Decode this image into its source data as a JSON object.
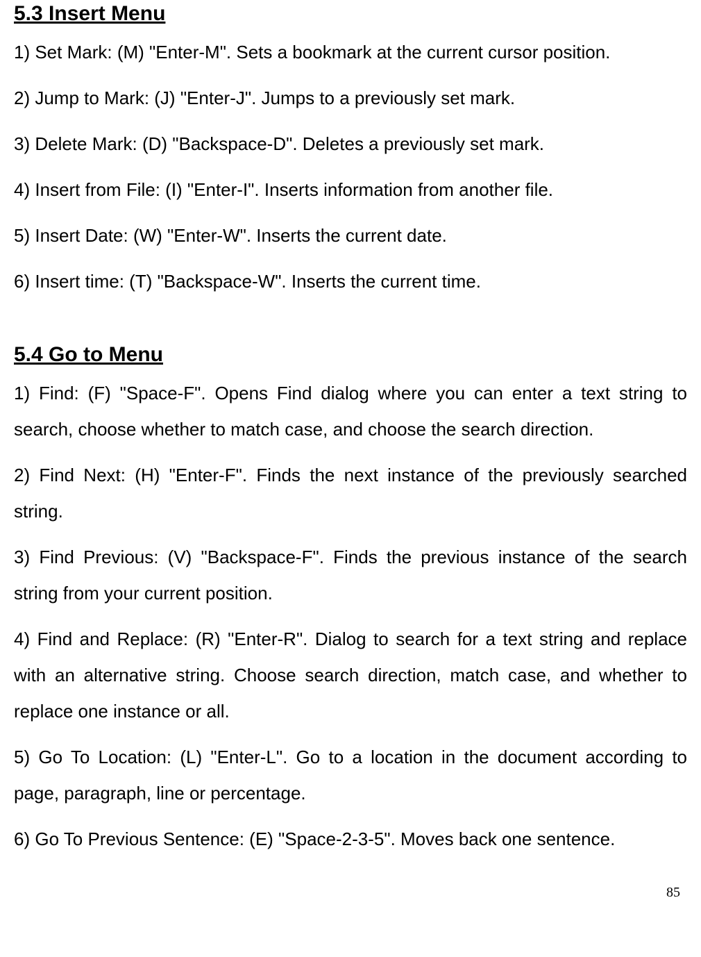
{
  "section53": {
    "heading": "5.3 Insert Menu",
    "items": [
      "1) Set Mark: (M) \"Enter-M\". Sets a bookmark at the current cursor position.",
      "2) Jump to Mark: (J) \"Enter-J\". Jumps to a previously set mark.",
      "3) Delete Mark: (D) \"Backspace-D\". Deletes a previously set mark.",
      "4) Insert from File: (I) \"Enter-I\". Inserts information from another file.",
      "5) Insert Date: (W) \"Enter-W\". Inserts the current date.",
      "6) Insert time: (T) \"Backspace-W\". Inserts the current time."
    ]
  },
  "section54": {
    "heading": "5.4 Go to Menu",
    "items": [
      "1) Find: (F) \"Space-F\". Opens Find dialog where you can enter a text string to search, choose whether to match case, and choose the search direction.",
      "2) Find Next: (H) \"Enter-F\". Finds the next instance of the previously searched string.",
      "3) Find Previous: (V) \"Backspace-F\". Finds the previous instance of the search string from your current position.",
      "4) Find and Replace: (R) \"Enter-R\". Dialog to search for a text string and replace with an alternative string. Choose search direction, match case, and whether to replace one instance or all.",
      "5) Go To Location: (L) \"Enter-L\". Go to a location in the document according to page, paragraph, line or percentage.",
      "6) Go To Previous Sentence: (E) \"Space-2-3-5\". Moves back one sentence."
    ]
  },
  "pageNumber": "85"
}
